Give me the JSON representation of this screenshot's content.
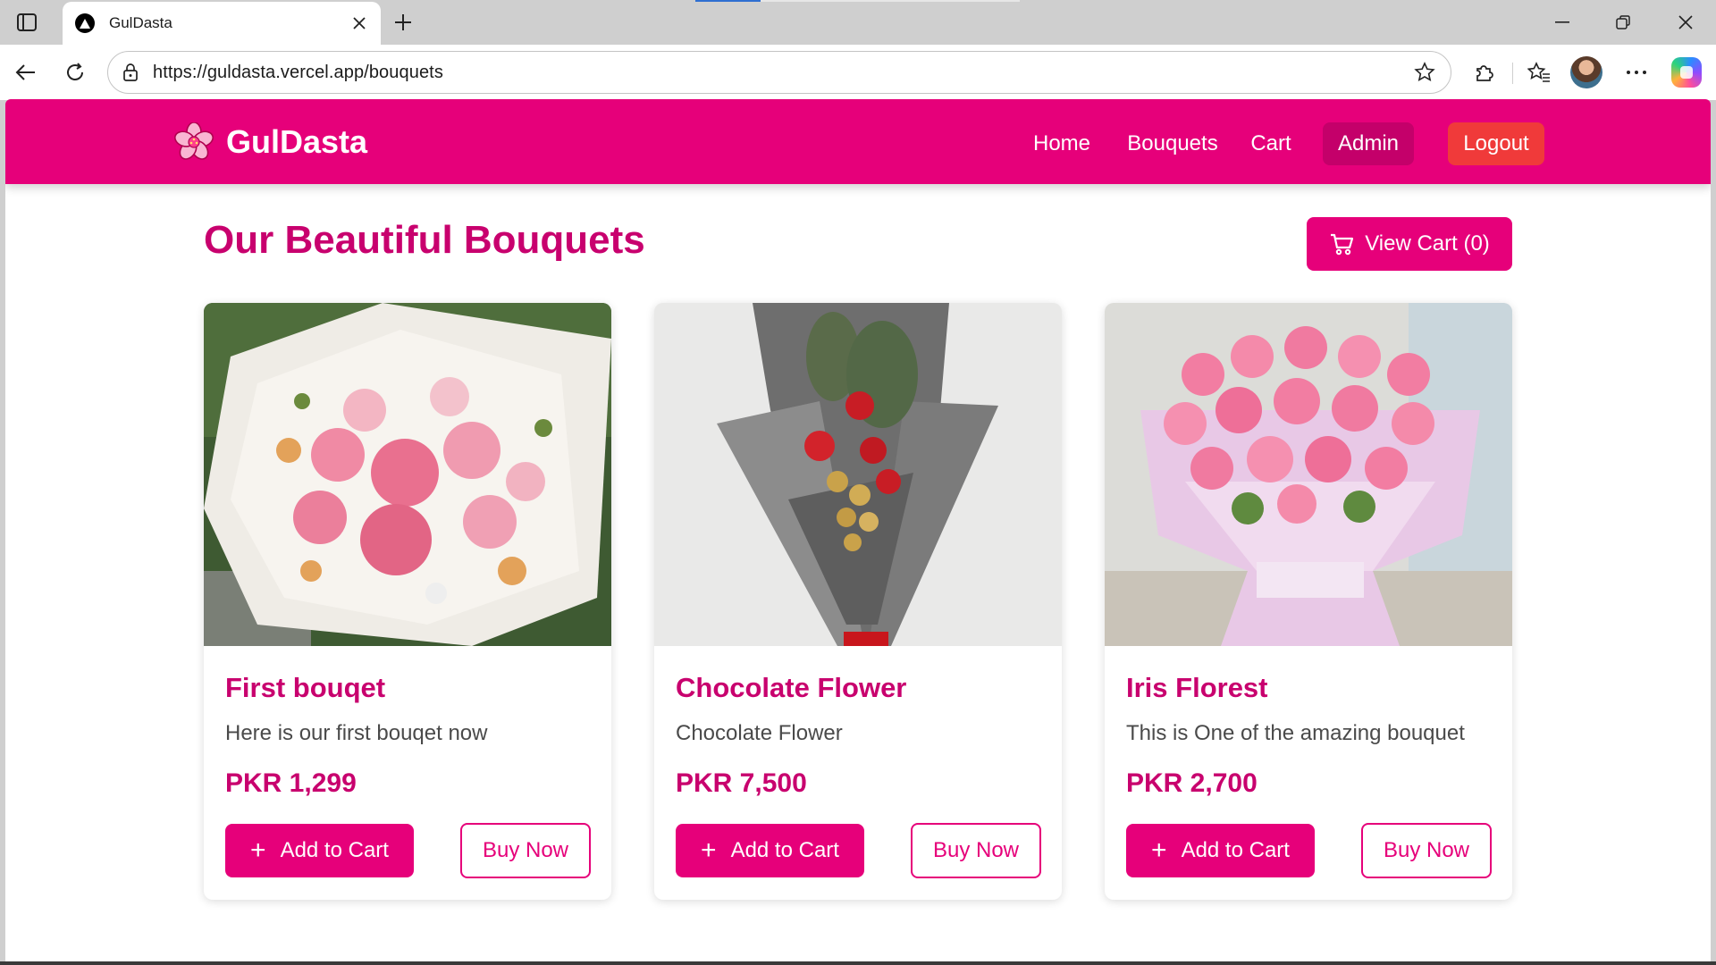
{
  "browser": {
    "tab_title": "GulDasta",
    "url": "https://guldasta.vercel.app/bouquets"
  },
  "site": {
    "brand": "GulDasta",
    "nav": {
      "home": "Home",
      "bouquets": "Bouquets",
      "cart": "Cart",
      "admin": "Admin",
      "logout": "Logout"
    }
  },
  "page": {
    "title": "Our Beautiful Bouquets",
    "view_cart_label": "View Cart (0)"
  },
  "products": [
    {
      "name": "First bouqet",
      "description": "Here is our first bouqet now",
      "price": "PKR 1,299",
      "add_label": "Add to Cart",
      "buy_label": "Buy Now"
    },
    {
      "name": "Chocolate Flower",
      "description": "Chocolate Flower",
      "price": "PKR 7,500",
      "add_label": "Add to Cart",
      "buy_label": "Buy Now"
    },
    {
      "name": "Iris Florest",
      "description": "This is One of the amazing bouquet",
      "price": "PKR 2,700",
      "add_label": "Add to Cart",
      "buy_label": "Buy Now"
    }
  ],
  "icons": {
    "tab_actions": "tab-actions-icon",
    "favicon": "triangle-logo-icon",
    "close_tab": "close-icon",
    "new_tab": "plus-icon",
    "back": "back-arrow-icon",
    "refresh": "refresh-icon",
    "lock": "lock-icon",
    "favorite": "star-icon",
    "extensions": "puzzle-icon",
    "favorites": "favorites-icon",
    "more": "more-icon",
    "brand_logo": "flower-icon",
    "cart": "cart-icon",
    "add": "plus-icon"
  },
  "colors": {
    "brand": "#e6007a",
    "brand_dark": "#c8006e",
    "admin_bg": "#c4006a",
    "logout_bg": "#f03a3a"
  }
}
